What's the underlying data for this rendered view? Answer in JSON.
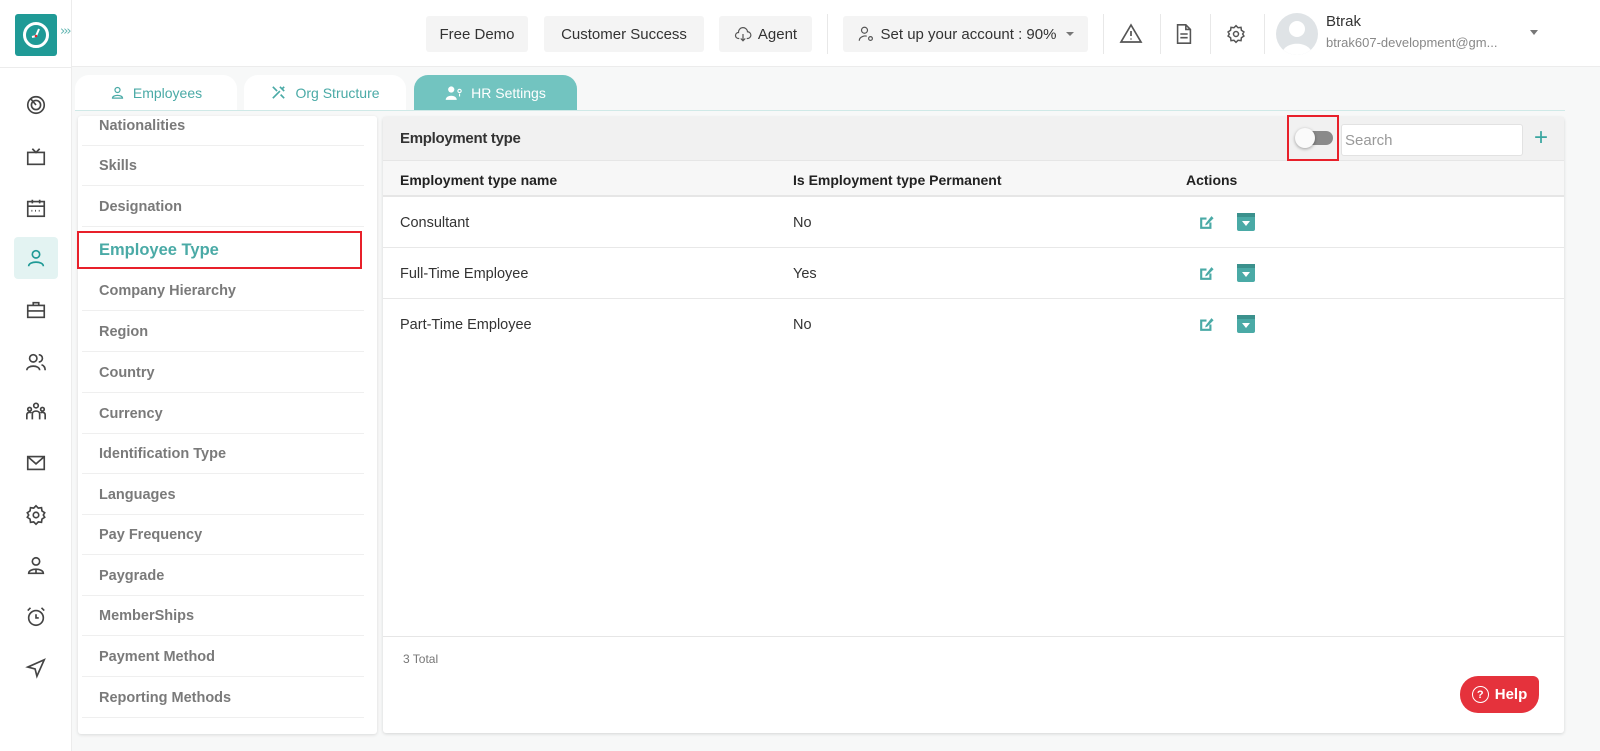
{
  "app": {
    "name": "Btrak",
    "logo_icon": "clock-icon",
    "expand_icon": "triple-chevron-right-icon",
    "accent_color": "#1f9a96",
    "highlight_color": "#e8202a"
  },
  "rail": {
    "items": [
      {
        "icon": "dashboard-target-icon",
        "active": false
      },
      {
        "icon": "tv-icon",
        "active": false
      },
      {
        "icon": "calendar-icon",
        "active": false
      },
      {
        "icon": "user-icon",
        "active": true
      },
      {
        "icon": "briefcase-icon",
        "active": false
      },
      {
        "icon": "users-icon",
        "active": false
      },
      {
        "icon": "team-icon",
        "active": false
      },
      {
        "icon": "mail-icon",
        "active": false
      },
      {
        "icon": "gear-icon",
        "active": false
      },
      {
        "icon": "person-badge-icon",
        "active": false
      },
      {
        "icon": "alarm-clock-icon",
        "active": false
      },
      {
        "icon": "send-icon",
        "active": false
      }
    ]
  },
  "topbar": {
    "free_demo": "Free Demo",
    "customer_success": "Customer Success",
    "agent": "Agent",
    "setup": "Set up your account : 90%",
    "setup_progress_percent": 90,
    "user": {
      "name": "Btrak",
      "email": "btrak607-development@gm..."
    }
  },
  "tabs": [
    {
      "label": "Employees",
      "icon": "user-icon",
      "active": false
    },
    {
      "label": "Org Structure",
      "icon": "tools-icon",
      "active": false
    },
    {
      "label": "HR Settings",
      "icon": "user-settings-icon",
      "active": true
    }
  ],
  "settings_menu": {
    "items": [
      {
        "label": "Nationalities"
      },
      {
        "label": "Skills"
      },
      {
        "label": "Designation"
      },
      {
        "label": "Employee Type",
        "active": true
      },
      {
        "label": "Company Hierarchy"
      },
      {
        "label": "Region"
      },
      {
        "label": "Country"
      },
      {
        "label": "Currency"
      },
      {
        "label": "Identification Type"
      },
      {
        "label": "Languages"
      },
      {
        "label": "Pay Frequency"
      },
      {
        "label": "Paygrade"
      },
      {
        "label": "MemberShips"
      },
      {
        "label": "Payment Method"
      },
      {
        "label": "Reporting Methods"
      }
    ]
  },
  "panel": {
    "title": "Employment type",
    "archive_toggle_on": false,
    "search_placeholder": "Search",
    "search_value": "",
    "add_label": "+",
    "columns": [
      "Employment type name",
      "Is Employment type Permanent",
      "Actions"
    ],
    "rows": [
      {
        "name": "Consultant",
        "permanent": "No"
      },
      {
        "name": "Full-Time Employee",
        "permanent": "Yes"
      },
      {
        "name": "Part-Time Employee",
        "permanent": "No"
      }
    ],
    "total": "3 Total"
  },
  "help": {
    "label": "Help",
    "icon_glyph": "?"
  }
}
